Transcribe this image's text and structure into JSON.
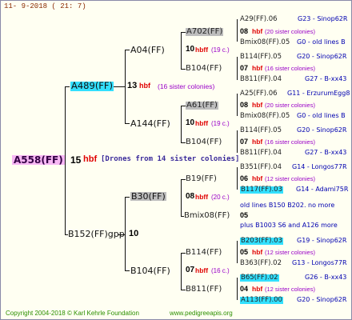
{
  "header": {
    "date": "11-  9-2018 (  21:  7)"
  },
  "root": {
    "name": "A558(FF)",
    "num": "15",
    "hbf": "hbf",
    "note": "[Drones from 14 sister colonies]"
  },
  "gen1": {
    "a": {
      "name": "A489(FF)",
      "num": "13",
      "hbf": "hbf",
      "note": "(16 sister colonies)"
    },
    "b": {
      "name": "B152(FF)gpp",
      "num": "10"
    }
  },
  "gen2": {
    "a": {
      "name": "A04(FF)",
      "num": "10",
      "hbf": "hbff",
      "note": "(19 c.)"
    },
    "b": {
      "name": "A144(FF)",
      "num": "10",
      "hbf": "hbff",
      "note": "(19 c.)"
    },
    "c": {
      "name": "B30(FF)",
      "num": "08",
      "hbf": "hbff",
      "note": "(20 c.)"
    },
    "d": {
      "name": "B104(FF)",
      "num": "07",
      "hbf": "hbff",
      "note": "(16 c.)"
    }
  },
  "gen3": {
    "a": {
      "name": "A702(FF)",
      "num": "08",
      "hbf": "hbf",
      "note": "(20 sister colonies)"
    },
    "b": {
      "name": "B104(FF)",
      "num": "07",
      "hbf": "hbf",
      "note": "(16 sister colonies)"
    },
    "c": {
      "name": "A61(FF)",
      "num": "08",
      "hbf": "hbf",
      "note": "(20 sister colonies)"
    },
    "d": {
      "name": "B104(FF)",
      "num": "07",
      "hbf": "hbf",
      "note": "(16 sister colonies)"
    },
    "e": {
      "name": "B19(FF)",
      "num": "06",
      "hbf": "hbf",
      "note": "(12 sister colonies)"
    },
    "f": {
      "name": "Bmix08(FF)",
      "num": "05",
      "line1": "old lines B150 B202.  no more",
      "line2": "plus B1003 S6 and A126 more"
    },
    "g": {
      "name": "B114(FF)",
      "num": "05",
      "hbf": "hbf",
      "note": "(12 sister colonies)"
    },
    "h": {
      "name": "B811(FF)",
      "num": "04",
      "hbf": "hbf",
      "note": "(12 sister colonies)"
    }
  },
  "gen4": [
    {
      "name": "A29(FF).06",
      "code": "G23 - Sinop62R"
    },
    {
      "name": "Bmix08(FF).05",
      "code": "G0 - old lines B"
    },
    {
      "name": "B114(FF).05",
      "code": "G20 - Sinop62R"
    },
    {
      "name": "B811(FF).04",
      "code": "G27 - B-xx43"
    },
    {
      "name": "A25(FF).06",
      "code": "G11 - ErzurumEgg8"
    },
    {
      "name": "Bmix08(FF).05",
      "code": "G0 - old lines B"
    },
    {
      "name": "B114(FF).05",
      "code": "G20 - Sinop62R"
    },
    {
      "name": "B811(FF).04",
      "code": "G27 - B-xx43"
    },
    {
      "name": "B351(FF).04",
      "code": "G14 - Longos77R"
    },
    {
      "name": "B117(FF).03",
      "code": "G14 - Adami75R"
    },
    {
      "name": "B203(FF).03",
      "code": "G19 - Sinop62R"
    },
    {
      "name": "B363(FF).02",
      "code": "G13 - Longos77R"
    },
    {
      "name": "B65(FF).02",
      "code": "G26 - B-xx43"
    },
    {
      "name": "A113(FF).00",
      "code": "G20 - Sinop62R"
    }
  ],
  "footer": {
    "copyright": "Copyright 2004-2018 © Karl Kehrle Foundation",
    "site": "www.pedigreeapis.org"
  }
}
